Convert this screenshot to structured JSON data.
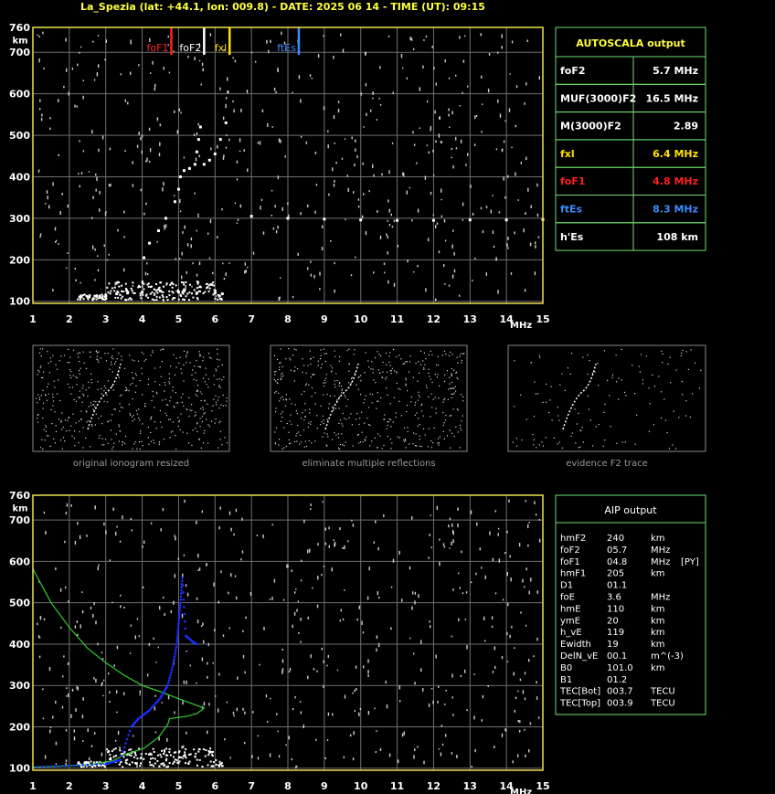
{
  "header": {
    "title": "La_Spezia (lat: +44.1, lon: 009.8) - DATE: 2025 06 14 - TIME (UT): 09:15"
  },
  "colors": {
    "frame": "#f0e050",
    "grid": "#707070",
    "panel_border": "#6fdc6f",
    "autoscala_title": "#ffff40",
    "foF1": "#ff2020",
    "fxl": "#ffe000",
    "ftEs": "#3a8cff",
    "trace": "#ffffff",
    "profile": "#30d030",
    "fit": "#1a2cff"
  },
  "chart_data": [
    {
      "id": "ionogram-top",
      "type": "scatter",
      "title": "",
      "xlabel": "MHz",
      "ylabel": "km",
      "xlim": [
        1,
        15
      ],
      "ylim": [
        95,
        760
      ],
      "x_ticks": [
        "1",
        "2",
        "3",
        "4",
        "5",
        "6",
        "7",
        "8",
        "9",
        "10",
        "11",
        "12",
        "13",
        "14",
        "15"
      ],
      "y_ticks": [
        "100",
        "200",
        "300",
        "400",
        "500",
        "600",
        "700",
        "760"
      ],
      "grid": true,
      "markers": [
        {
          "label": "foF1",
          "x": 4.8,
          "color": "#ff2020"
        },
        {
          "label": "foF2",
          "x": 5.7,
          "color": "#ffffff"
        },
        {
          "label": "fxl",
          "x": 6.4,
          "color": "#ffe000"
        },
        {
          "label": "ftEs",
          "x": 8.3,
          "color": "#3a8cff"
        }
      ],
      "traces": {
        "F2_o": [
          [
            4.05,
            205
          ],
          [
            4.2,
            240
          ],
          [
            4.45,
            270
          ],
          [
            4.65,
            300
          ],
          [
            4.9,
            340
          ],
          [
            5.0,
            370
          ],
          [
            5.05,
            400
          ],
          [
            5.15,
            415
          ],
          [
            5.3,
            420
          ],
          [
            5.45,
            430
          ],
          [
            5.5,
            460
          ],
          [
            5.55,
            490
          ],
          [
            5.6,
            520
          ]
        ],
        "F2_x": [
          [
            5.7,
            430
          ],
          [
            5.85,
            440
          ],
          [
            6.0,
            455
          ],
          [
            6.15,
            490
          ],
          [
            6.3,
            530
          ]
        ],
        "E_layer": [
          [
            3.0,
            115
          ],
          [
            3.3,
            118
          ],
          [
            3.6,
            120
          ],
          [
            4.0,
            122
          ],
          [
            4.5,
            125
          ],
          [
            5.0,
            122
          ],
          [
            5.5,
            120
          ],
          [
            6.0,
            120
          ],
          [
            6.2,
            118
          ]
        ],
        "Es_layer": [
          [
            7.0,
            305
          ],
          [
            8.0,
            300
          ],
          [
            9.0,
            298
          ],
          [
            10.0,
            296
          ],
          [
            11.0,
            295
          ],
          [
            12.0,
            295
          ],
          [
            13.0,
            296
          ],
          [
            14.0,
            296
          ],
          [
            15.0,
            297
          ]
        ]
      }
    },
    {
      "id": "ionogram-bottom",
      "type": "scatter",
      "title": "",
      "xlabel": "MHz",
      "ylabel": "km",
      "xlim": [
        1,
        15
      ],
      "ylim": [
        95,
        760
      ],
      "x_ticks": [
        "1",
        "2",
        "3",
        "4",
        "5",
        "6",
        "7",
        "8",
        "9",
        "10",
        "11",
        "12",
        "13",
        "14",
        "15"
      ],
      "y_ticks": [
        "100",
        "200",
        "300",
        "400",
        "500",
        "600",
        "700",
        "760"
      ],
      "grid": true,
      "profile": [
        [
          1.0,
          582
        ],
        [
          1.5,
          500
        ],
        [
          2.0,
          440
        ],
        [
          2.5,
          390
        ],
        [
          3.0,
          355
        ],
        [
          3.5,
          325
        ],
        [
          4.0,
          300
        ],
        [
          4.5,
          285
        ],
        [
          5.0,
          268
        ],
        [
          5.4,
          255
        ],
        [
          5.7,
          245
        ],
        [
          5.5,
          232
        ],
        [
          5.2,
          225
        ],
        [
          4.75,
          220
        ],
        [
          4.7,
          205
        ],
        [
          4.45,
          175
        ],
        [
          4.05,
          148
        ],
        [
          3.7,
          138
        ],
        [
          3.5,
          132
        ],
        [
          3.2,
          118
        ],
        [
          2.5,
          108
        ],
        [
          1.0,
          102
        ]
      ],
      "fitted_trace": [
        [
          1.0,
          103
        ],
        [
          2.0,
          106
        ],
        [
          3.0,
          110
        ],
        [
          3.4,
          120
        ],
        [
          3.7,
          200
        ],
        [
          3.9,
          220
        ],
        [
          4.2,
          240
        ],
        [
          4.5,
          270
        ],
        [
          4.7,
          300
        ],
        [
          4.85,
          350
        ],
        [
          4.95,
          400
        ],
        [
          5.0,
          450
        ],
        [
          5.05,
          500
        ],
        [
          5.1,
          560
        ],
        [
          5.2,
          420
        ],
        [
          5.4,
          405
        ],
        [
          5.5,
          400
        ]
      ]
    }
  ],
  "previews": [
    {
      "caption": "original ionogram resized"
    },
    {
      "caption": "eliminate multiple reflections"
    },
    {
      "caption": "evidence F2 trace"
    }
  ],
  "autoscala": {
    "title": "AUTOSCALA output",
    "rows": [
      {
        "label": "foF2",
        "value": "5.7 MHz",
        "color": "#ffffff"
      },
      {
        "label": "MUF(3000)F2",
        "value": "16.5 MHz",
        "color": "#ffffff"
      },
      {
        "label": "M(3000)F2",
        "value": "2.89",
        "color": "#ffffff"
      },
      {
        "label": "fxl",
        "value": "6.4 MHz",
        "color": "#ffe000"
      },
      {
        "label": "foF1",
        "value": "4.8 MHz",
        "color": "#ff2020"
      },
      {
        "label": "ftEs",
        "value": "8.3 MHz",
        "color": "#3a8cff"
      },
      {
        "label": "h'Es",
        "value": "108    km",
        "color": "#ffffff"
      }
    ]
  },
  "aip": {
    "title": "AIP output",
    "rows": [
      {
        "label": "hmF2",
        "value": "240",
        "unit": "km",
        "extra": ""
      },
      {
        "label": "foF2",
        "value": "05.7",
        "unit": "MHz",
        "extra": ""
      },
      {
        "label": "foF1",
        "value": "04.8",
        "unit": "MHz",
        "extra": "[PY]"
      },
      {
        "label": "hmF1",
        "value": "205",
        "unit": "km",
        "extra": ""
      },
      {
        "label": "D1",
        "value": "01.1",
        "unit": "",
        "extra": ""
      },
      {
        "label": "foE",
        "value": "3.6",
        "unit": "MHz",
        "extra": ""
      },
      {
        "label": "hmE",
        "value": "110",
        "unit": "km",
        "extra": ""
      },
      {
        "label": "ymE",
        "value": "20",
        "unit": "km",
        "extra": ""
      },
      {
        "label": "h_vE",
        "value": "119",
        "unit": "km",
        "extra": ""
      },
      {
        "label": "Ewidth",
        "value": "19",
        "unit": "km",
        "extra": ""
      },
      {
        "label": "DelN_vE",
        "value": "00.1",
        "unit": "m^(-3)",
        "extra": ""
      },
      {
        "label": "B0",
        "value": "101.0",
        "unit": "km",
        "extra": ""
      },
      {
        "label": "B1",
        "value": "01.2",
        "unit": "",
        "extra": ""
      },
      {
        "label": "TEC[Bot]",
        "value": "003.7",
        "unit": "TECU",
        "extra": ""
      },
      {
        "label": "TEC[Top]",
        "value": "003.9",
        "unit": "TECU",
        "extra": ""
      }
    ]
  }
}
